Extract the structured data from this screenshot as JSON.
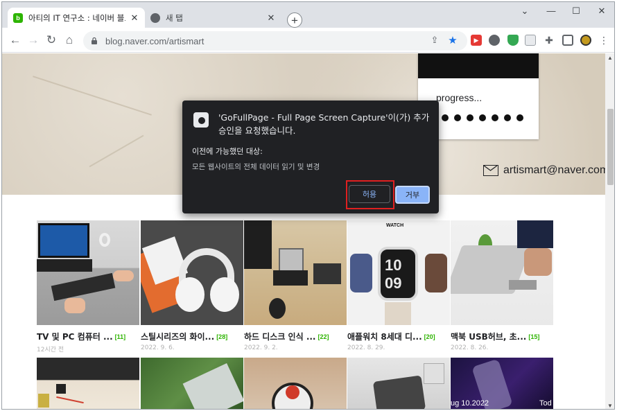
{
  "browser": {
    "tabs": [
      {
        "title": "아티의 IT 연구소 : 네이버 블로그",
        "favicon": "naver-icon",
        "active": true
      },
      {
        "title": "새 탭",
        "favicon": "chrome-icon",
        "active": false
      }
    ],
    "new_tab_label": "+",
    "url": "blog.naver.com/artismart",
    "window_controls": {
      "dropdown": "⌄",
      "minimize": "—",
      "maximize": "☐",
      "close": "✕"
    }
  },
  "header": {
    "progress_text": "progress...",
    "email": "artismart@naver.com"
  },
  "dialog": {
    "title": "'GoFullPage - Full Page Screen Capture'이(가) 추가 승인을 요청했습니다.",
    "subtitle": "이전에 가능했던 대상:",
    "permission": "모든 웹사이트의 전체 데이터 읽기 및 변경",
    "allow_label": "허용",
    "deny_label": "거부",
    "highlight_color": "#e02020"
  },
  "posts": [
    {
      "title": "TV 및 PC 컴퓨터 ...",
      "count": "[11]",
      "date": "12시간 전"
    },
    {
      "title": "스틸시리즈의 화이...",
      "count": "[28]",
      "date": "2022. 9. 6."
    },
    {
      "title": "하드 디스크 인식 ...",
      "count": "[22]",
      "date": "2022. 9. 2."
    },
    {
      "title": "애플워치 8세대 디...",
      "count": "[20]",
      "date": "2022. 8. 29."
    },
    {
      "title": "맥북 USB허브, 초...",
      "count": "[15]",
      "date": "2022. 8. 26."
    }
  ],
  "thumb_overlay_texts": {
    "watch_brand": "WATCH",
    "watch_time_h": "10",
    "watch_time_m": "09",
    "event_date": "ug 10.2022",
    "event_tod": "Tod"
  },
  "colors": {
    "accent": "#2db400",
    "dialog_bg": "#202124",
    "deny_bg": "#8ab4f8",
    "arrow": "#e8703a"
  }
}
